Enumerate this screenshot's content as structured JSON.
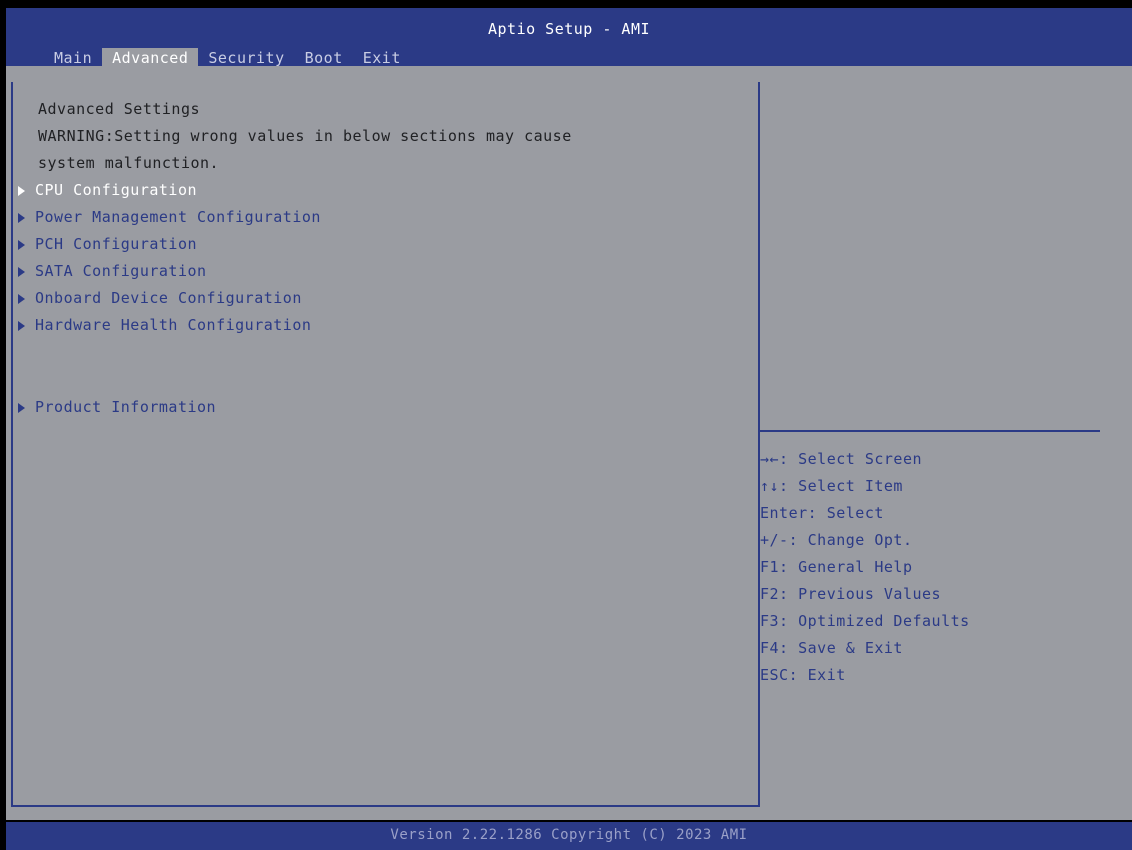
{
  "header": {
    "title": "Aptio Setup - AMI",
    "tabs": [
      {
        "label": "Main",
        "active": false
      },
      {
        "label": "Advanced",
        "active": true
      },
      {
        "label": "Security",
        "active": false
      },
      {
        "label": "Boot",
        "active": false
      },
      {
        "label": "Exit",
        "active": false
      }
    ]
  },
  "main": {
    "heading": "Advanced Settings",
    "warning_line1": "WARNING:Setting wrong values in below sections may cause",
    "warning_line2": "system malfunction.",
    "menu_items": [
      {
        "label": "CPU Configuration",
        "selected": true
      },
      {
        "label": "Power Management Configuration",
        "selected": false
      },
      {
        "label": "PCH Configuration",
        "selected": false
      },
      {
        "label": "SATA Configuration",
        "selected": false
      },
      {
        "label": "Onboard Device Configuration",
        "selected": false
      },
      {
        "label": "Hardware Health Configuration",
        "selected": false
      }
    ],
    "extra_items": [
      {
        "label": "Product Information",
        "selected": false
      }
    ]
  },
  "help": {
    "lines": [
      "→←: Select Screen",
      "↑↓: Select Item",
      "Enter: Select",
      "+/-: Change Opt.",
      "F1: General Help",
      "F2: Previous Values",
      "F3: Optimized Defaults",
      "F4: Save & Exit",
      "ESC: Exit"
    ]
  },
  "footer": {
    "version": "Version 2.22.1286 Copyright (C) 2023 AMI"
  },
  "colors": {
    "bar_blue": "#2b3a86",
    "panel_gray": "#9a9ca2",
    "highlight_text": "#ffffff"
  }
}
